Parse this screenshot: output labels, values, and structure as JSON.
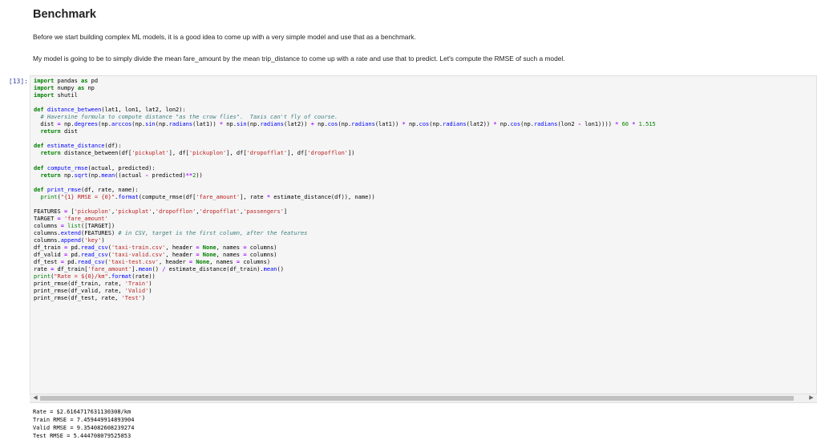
{
  "markdown": {
    "heading": "Benchmark",
    "para1": "Before we start building complex ML models, it is a good idea to come up with a very simple model and use that as a benchmark.",
    "para2": "My model is going to be to simply divide the mean fare_amount by the mean trip_distance to come up with a rate and use that to predict. Let's compute the RMSE of such a model."
  },
  "cell": {
    "prompt": "[13]:",
    "code_lines": [
      "import pandas as pd",
      "import numpy as np",
      "import shutil",
      "",
      "def distance_between(lat1, lon1, lat2, lon2):",
      "  # Haversine formula to compute distance \"as the crow flies\".  Taxis can't fly of course.",
      "  dist = np.degrees(np.arccos(np.sin(np.radians(lat1)) * np.sin(np.radians(lat2)) + np.cos(np.radians(lat1)) * np.cos(np.radians(lat2)) * np.cos(np.radians(lon2 - lon1)))) * 60 * 1.515",
      "  return dist",
      "",
      "def estimate_distance(df):",
      "  return distance_between(df['pickuplat'], df['pickuplon'], df['dropofflat'], df['dropofflon'])",
      "",
      "def compute_rmse(actual, predicted):",
      "  return np.sqrt(np.mean((actual - predicted)**2))",
      "",
      "def print_rmse(df, rate, name):",
      "  print(\"{1} RMSE = {0}\".format(compute_rmse(df['fare_amount'], rate * estimate_distance(df)), name))",
      "",
      "FEATURES = ['pickuplon','pickuplat','dropofflon','dropofflat','passengers']",
      "TARGET = 'fare_amount'",
      "columns = list([TARGET])",
      "columns.extend(FEATURES) # in CSV, target is the first column, after the features",
      "columns.append('key')",
      "df_train = pd.read_csv('taxi-train.csv', header = None, names = columns)",
      "df_valid = pd.read_csv('taxi-valid.csv', header = None, names = columns)",
      "df_test = pd.read_csv('taxi-test.csv', header = None, names = columns)",
      "rate = df_train['fare_amount'].mean() / estimate_distance(df_train).mean()",
      "print(\"Rate = ${0}/km\".format(rate))",
      "print_rmse(df_train, rate, 'Train')",
      "print_rmse(df_valid, rate, 'Valid')",
      "print_rmse(df_test, rate, 'Test')"
    ],
    "output_lines": [
      "Rate = $2.6164717631130308/km",
      "Train RMSE = 7.459449914893904",
      "Valid RMSE = 9.354082608239274",
      "Test RMSE = 5.444708079525853"
    ],
    "scroll_left_glyph": "◀",
    "scroll_right_glyph": "▶"
  },
  "colors": {
    "keyword": "#008000",
    "builtin_call": "#0000ff",
    "string": "#ba2121",
    "comment": "#408080",
    "prompt": "#303f9f"
  }
}
